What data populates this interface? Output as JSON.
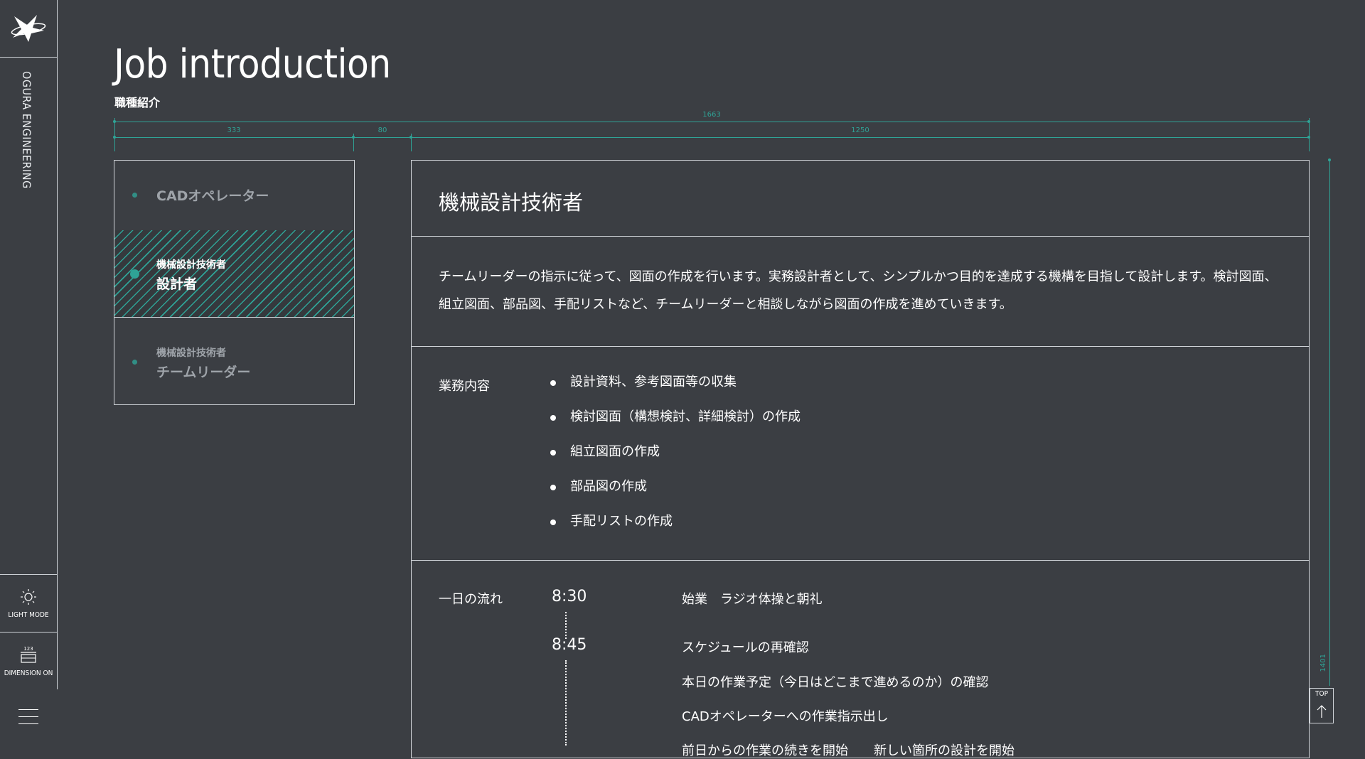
{
  "brand": {
    "name": "OGURA ENGINEERING"
  },
  "rail": {
    "light_mode_label": "LIGHT MODE",
    "dimension_label": "DIMENSION ON",
    "dimension_icon_text": "123"
  },
  "page": {
    "title": "Job introduction",
    "subtitle": "職種紹介"
  },
  "dimensions": {
    "total": "1663",
    "side": "333",
    "gap": "80",
    "main": "1250",
    "height": "1401"
  },
  "side_menu": {
    "items": [
      {
        "small": "",
        "large": "CADオペレーター",
        "active": false
      },
      {
        "small": "機械設計技術者",
        "large": "設計者",
        "active": true
      },
      {
        "small": "機械設計技術者",
        "large": "チームリーダー",
        "active": false
      }
    ]
  },
  "main": {
    "title": "機械設計技術者",
    "description": "チームリーダーの指示に従って、図面の作成を行います。実務設計者として、シンプルかつ目的を達成する機構を目指して設計します。検討図面、組立図面、部品図、手配リストなど、チームリーダーと相談しながら図面の作成を進めていきます。",
    "duties_label": "業務内容",
    "duties": [
      "設計資料、参考図面等の収集",
      "検討図面（構想検討、詳細検討）の作成",
      "組立図面の作成",
      "部品図の作成",
      "手配リストの作成"
    ],
    "flow_label": "一日の流れ",
    "flow": [
      {
        "time": "8:30",
        "items": [
          "始業　ラジオ体操と朝礼"
        ]
      },
      {
        "time": "8:45",
        "items": [
          "スケジュールの再確認",
          "本日の作業予定（今日はどこまで進めるのか）の確認",
          "CADオペレーターへの作業指示出し",
          "前日からの作業の続きを開始　　新しい箇所の設計を開始"
        ]
      }
    ]
  },
  "top_button": {
    "label": "TOP"
  },
  "colors": {
    "background": "#3b3e43",
    "accent": "#2fa396",
    "line": "#cfd3d8"
  }
}
